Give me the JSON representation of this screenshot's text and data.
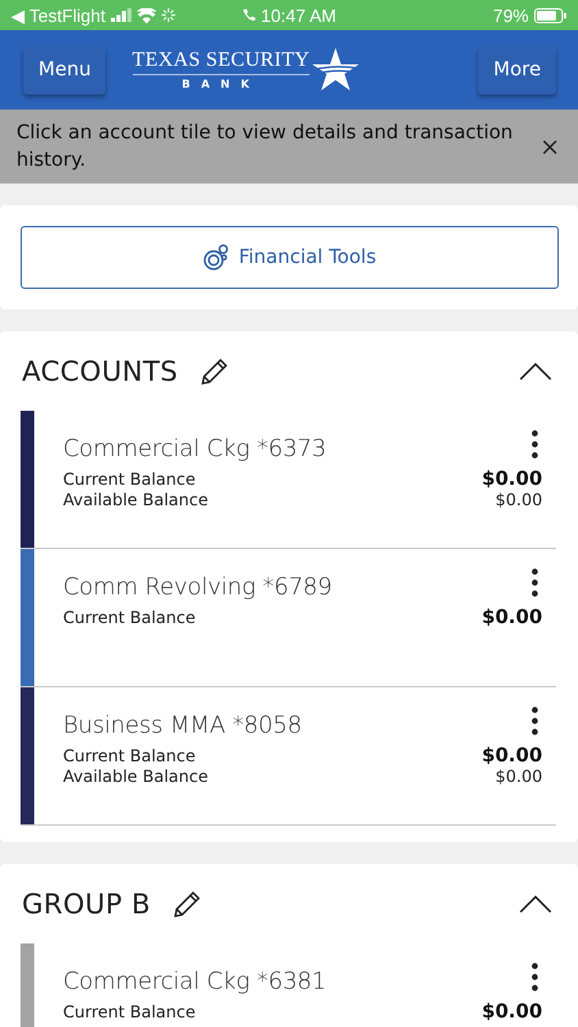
{
  "status_bar": {
    "back": "◀ TestFlight",
    "time": "10:47 AM",
    "battery": "79%"
  },
  "header": {
    "menu": "Menu",
    "logo_top": "TEXAS SECURITY",
    "logo_bottom": "BANK",
    "more": "More"
  },
  "banner": {
    "message": "Click an account tile to view details and transaction history."
  },
  "financial_tools": {
    "label": "Financial Tools"
  },
  "groups": [
    {
      "title": "ACCOUNTS",
      "expanded": true,
      "accounts": [
        {
          "name": "Commercial Ckg *6373",
          "color": "#1f2354",
          "lines": [
            {
              "label": "Current Balance",
              "amount": "$0.00"
            },
            {
              "label": "Available Balance",
              "amount": "$0.00"
            }
          ]
        },
        {
          "name": "Comm Revolving *6789",
          "color": "#3a6cb4",
          "lines": [
            {
              "label": "Current Balance",
              "amount": "$0.00"
            }
          ]
        },
        {
          "name": "Business MMA *8058",
          "color": "#25285a",
          "lines": [
            {
              "label": "Current Balance",
              "amount": "$0.00"
            },
            {
              "label": "Available Balance",
              "amount": "$0.00"
            }
          ]
        }
      ]
    },
    {
      "title": "GROUP B",
      "expanded": true,
      "accounts": [
        {
          "name": "Commercial Ckg *6381",
          "color": "#a3a3a3",
          "lines": [
            {
              "label": "Current Balance",
              "amount": "$0.00"
            }
          ]
        }
      ]
    }
  ]
}
